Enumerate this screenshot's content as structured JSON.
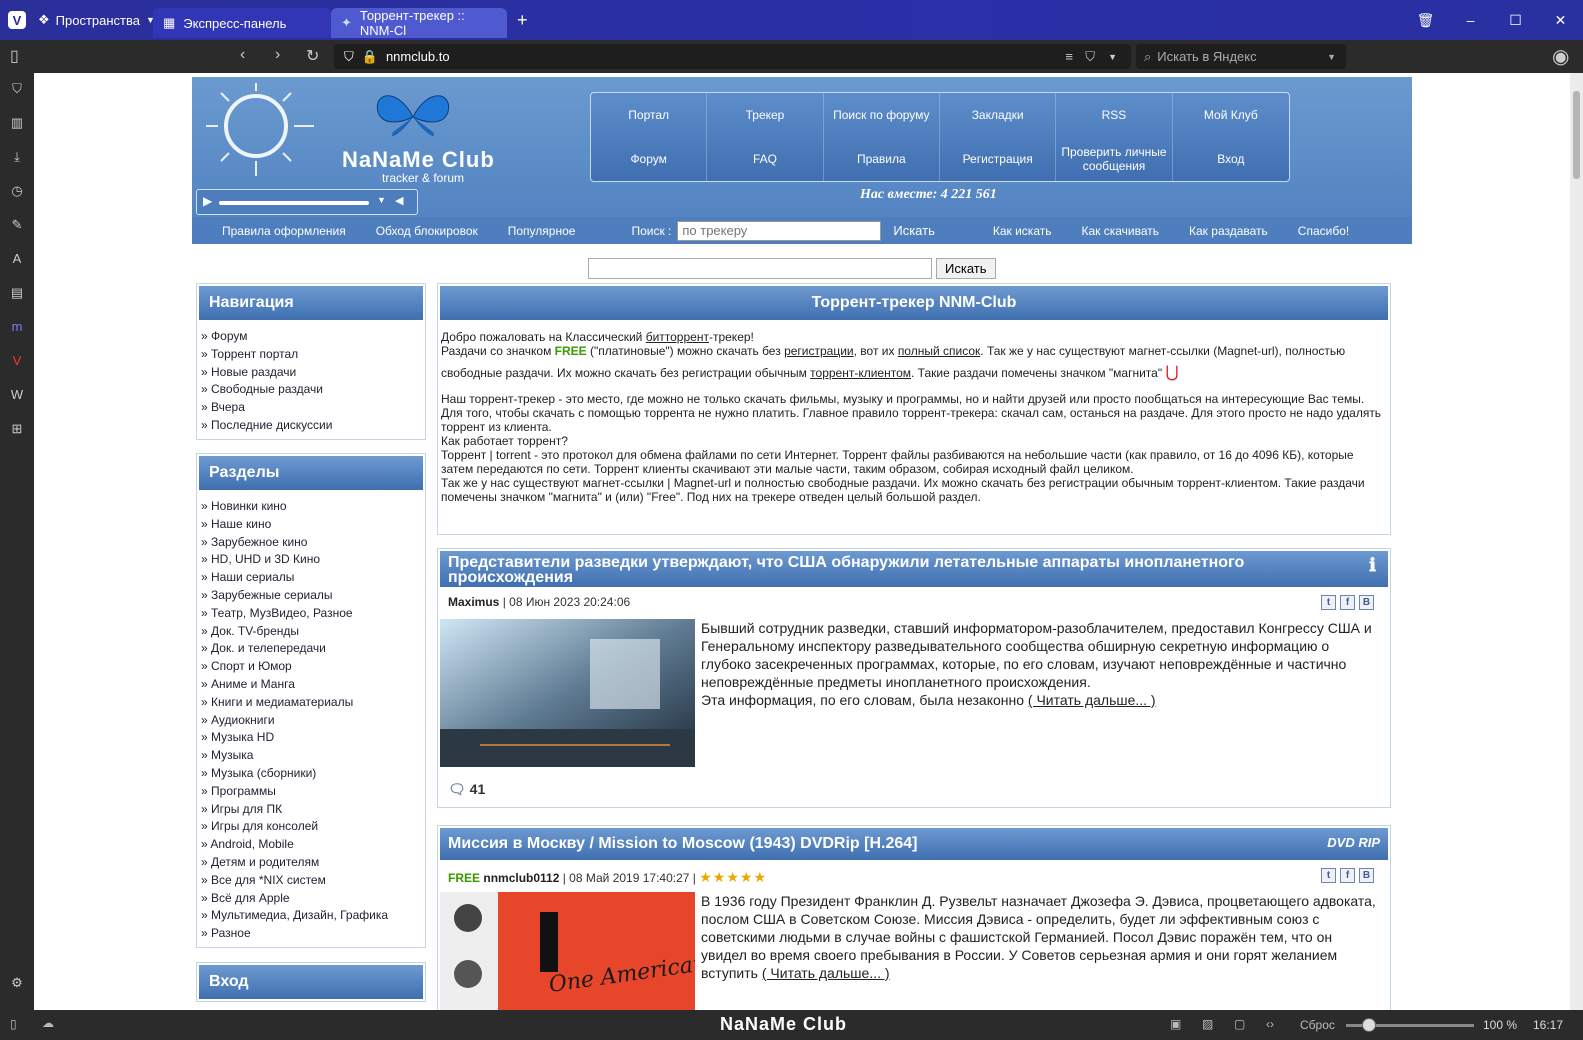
{
  "browser": {
    "spaces_label": "Пространства",
    "tabs": [
      {
        "label": "Экспресс-панель"
      },
      {
        "label": "Торрент-трекер :: NNM-Cl"
      }
    ],
    "address": "nnmclub.to",
    "search_placeholder": "Искать в Яндекс",
    "status": {
      "reset": "Сброс",
      "zoom": "100 %",
      "time": "16:17",
      "brand": "NaNaMe Club"
    }
  },
  "site": {
    "logo_title": "NaNaMe Club",
    "logo_subtitle": "tracker & forum",
    "menu": [
      "Портал",
      "Трекер",
      "Поиск по форуму",
      "Закладки",
      "RSS",
      "Мой Клуб",
      "Форум",
      "FAQ",
      "Правила",
      "Регистрация",
      "Проверить личные сообщения",
      "Вход"
    ],
    "together": "Нас вместе: 4 221 561",
    "subnav_left": [
      "Правила оформления",
      "Обход блокировок",
      "Популярное"
    ],
    "search_label": "Поиск :",
    "search_placeholder": "по трекеру",
    "search_button": "Искать",
    "subnav_right": [
      "Как искать",
      "Как скачивать",
      "Как раздавать",
      "Спасибо!"
    ],
    "global_search_button": "Искать"
  },
  "navigation": {
    "title": "Навигация",
    "items": [
      "Форум",
      "Торрент портал",
      "Новые раздачи",
      "Свободные раздачи",
      "Вчера",
      "Последние дискуссии"
    ]
  },
  "sections": {
    "title": "Разделы",
    "items": [
      "Новинки кино",
      "Наше кино",
      "Зарубежное кино",
      "HD, UHD и 3D Кино",
      "Наши сериалы",
      "Зарубежные сериалы",
      "Театр, МузВидео, Разное",
      "Док. TV-бренды",
      "Док. и телепередачи",
      "Спорт и Юмор",
      "Аниме и Манга",
      "Книги и медиаматериалы",
      "Аудиокниги",
      "Музыка HD",
      "Музыка",
      "Музыка (сборники)",
      "Программы",
      "Игры для ПК",
      "Игры для консолей",
      "Android, Mobile",
      "Детям и родителям",
      "Все для *NIX систем",
      "Всё для Apple",
      "Мультимедиа, Дизайн, Графика",
      "Разное"
    ]
  },
  "login": {
    "title": "Вход"
  },
  "main": {
    "title": "Торрент-трекер NNM-Club",
    "welcome": {
      "l1a": "Добро пожаловать на Классический ",
      "l1link": "битторрент",
      "l1b": "-трекер!",
      "l2a": "Раздачи со значком ",
      "free": "FREE",
      "l2b": " (\"платиновые\") можно скачать без ",
      "l2link1": "регистрации",
      "l2c": ", вот их ",
      "l2link2": "полный список",
      "l2d": ". Так же у нас существуют магнет-ссылки (Magnet-url), полностью",
      "l3a": "свободные раздачи. Их можно скачать без регистрации обычным ",
      "l3link": "торрент-клиентом",
      "l3b": ". Такие раздачи помечены значком \"магнита\"",
      "p2": "Наш торрент-трекер - это место, где можно не только скачать фильмы, музыку и программы, но и найти друзей или просто пообщаться на интересующие Вас темы. Для того, чтобы скачать с помощью торрента не нужно платить. Главное правило торрент-трекера: скачал сам, останься на раздаче. Для этого просто не надо удалять торрент из клиента.",
      "p3": "Как работает торрент?",
      "p4": "Торрент | torrent - это протокол для обмена файлами по сети Интернет. Торрент файлы разбиваются на небольшие части (как правило, от 16 до 4096 КБ), которые затем передаются по сети. Торрент клиенты скачивают эти малые части, таким образом, собирая исходный файл целиком.",
      "p5": "Так же у нас существуют магнет-ссылки | Magnet-url и полностью свободные раздачи. Их можно скачать без регистрации обычным торрент-клиентом. Такие раздачи помечены значком \"магнита\" и (или) \"Free\". Под них на трекере отведен целый большой раздел."
    },
    "news": [
      {
        "title": "Представители разведки утверждают, что США обнаружили летательные аппараты инопланетного происхождения",
        "author": "Maximus",
        "date": "| 08 Июн 2023 20:24:06",
        "text": "Бывший сотрудник разведки, ставший информатором-разоблачителем, предоставил Конгрессу США и Генеральному инспектору разведывательного сообщества обширную секретную информацию о глубоко засекреченных программах, которые, по его словам, изучают неповреждённые и частично неповреждённые предметы инопланетного происхождения.",
        "text2": "Эта информация, по его словам, была незаконно ",
        "more": "( Читать дальше... )",
        "comments": "41"
      },
      {
        "title": "Миссия в Москву / Mission to Moscow (1943) DVDRip [H.264]",
        "free": "FREE",
        "author": "nnmclub0112",
        "date": "| 08 Май 2019 17:40:27 |",
        "stars": "★★★★★",
        "badge": "DVD RIP",
        "text": "В 1936 году Президент Франклин Д. Рузвельт назначает Джозефа Э. Дэвиса, процветающего адвоката, послом США в Советском Союзе. Миссия Дэвиса - определить, будет ли эффективным союз с советскими людьми в случае войны с фашистской Германией. Посол Дэвис поражён тем, что он увидел во время своего пребывания в России. У Советов серьезная армия и они горят желанием вступить ",
        "more": "( Читать дальше... )",
        "poster_text": "One American's"
      }
    ]
  },
  "colors": {
    "header_blue": "#4f80bf",
    "browser_tabbar": "#2a2f9a",
    "free_green": "#3a9a00",
    "stars": "#e8a800"
  }
}
